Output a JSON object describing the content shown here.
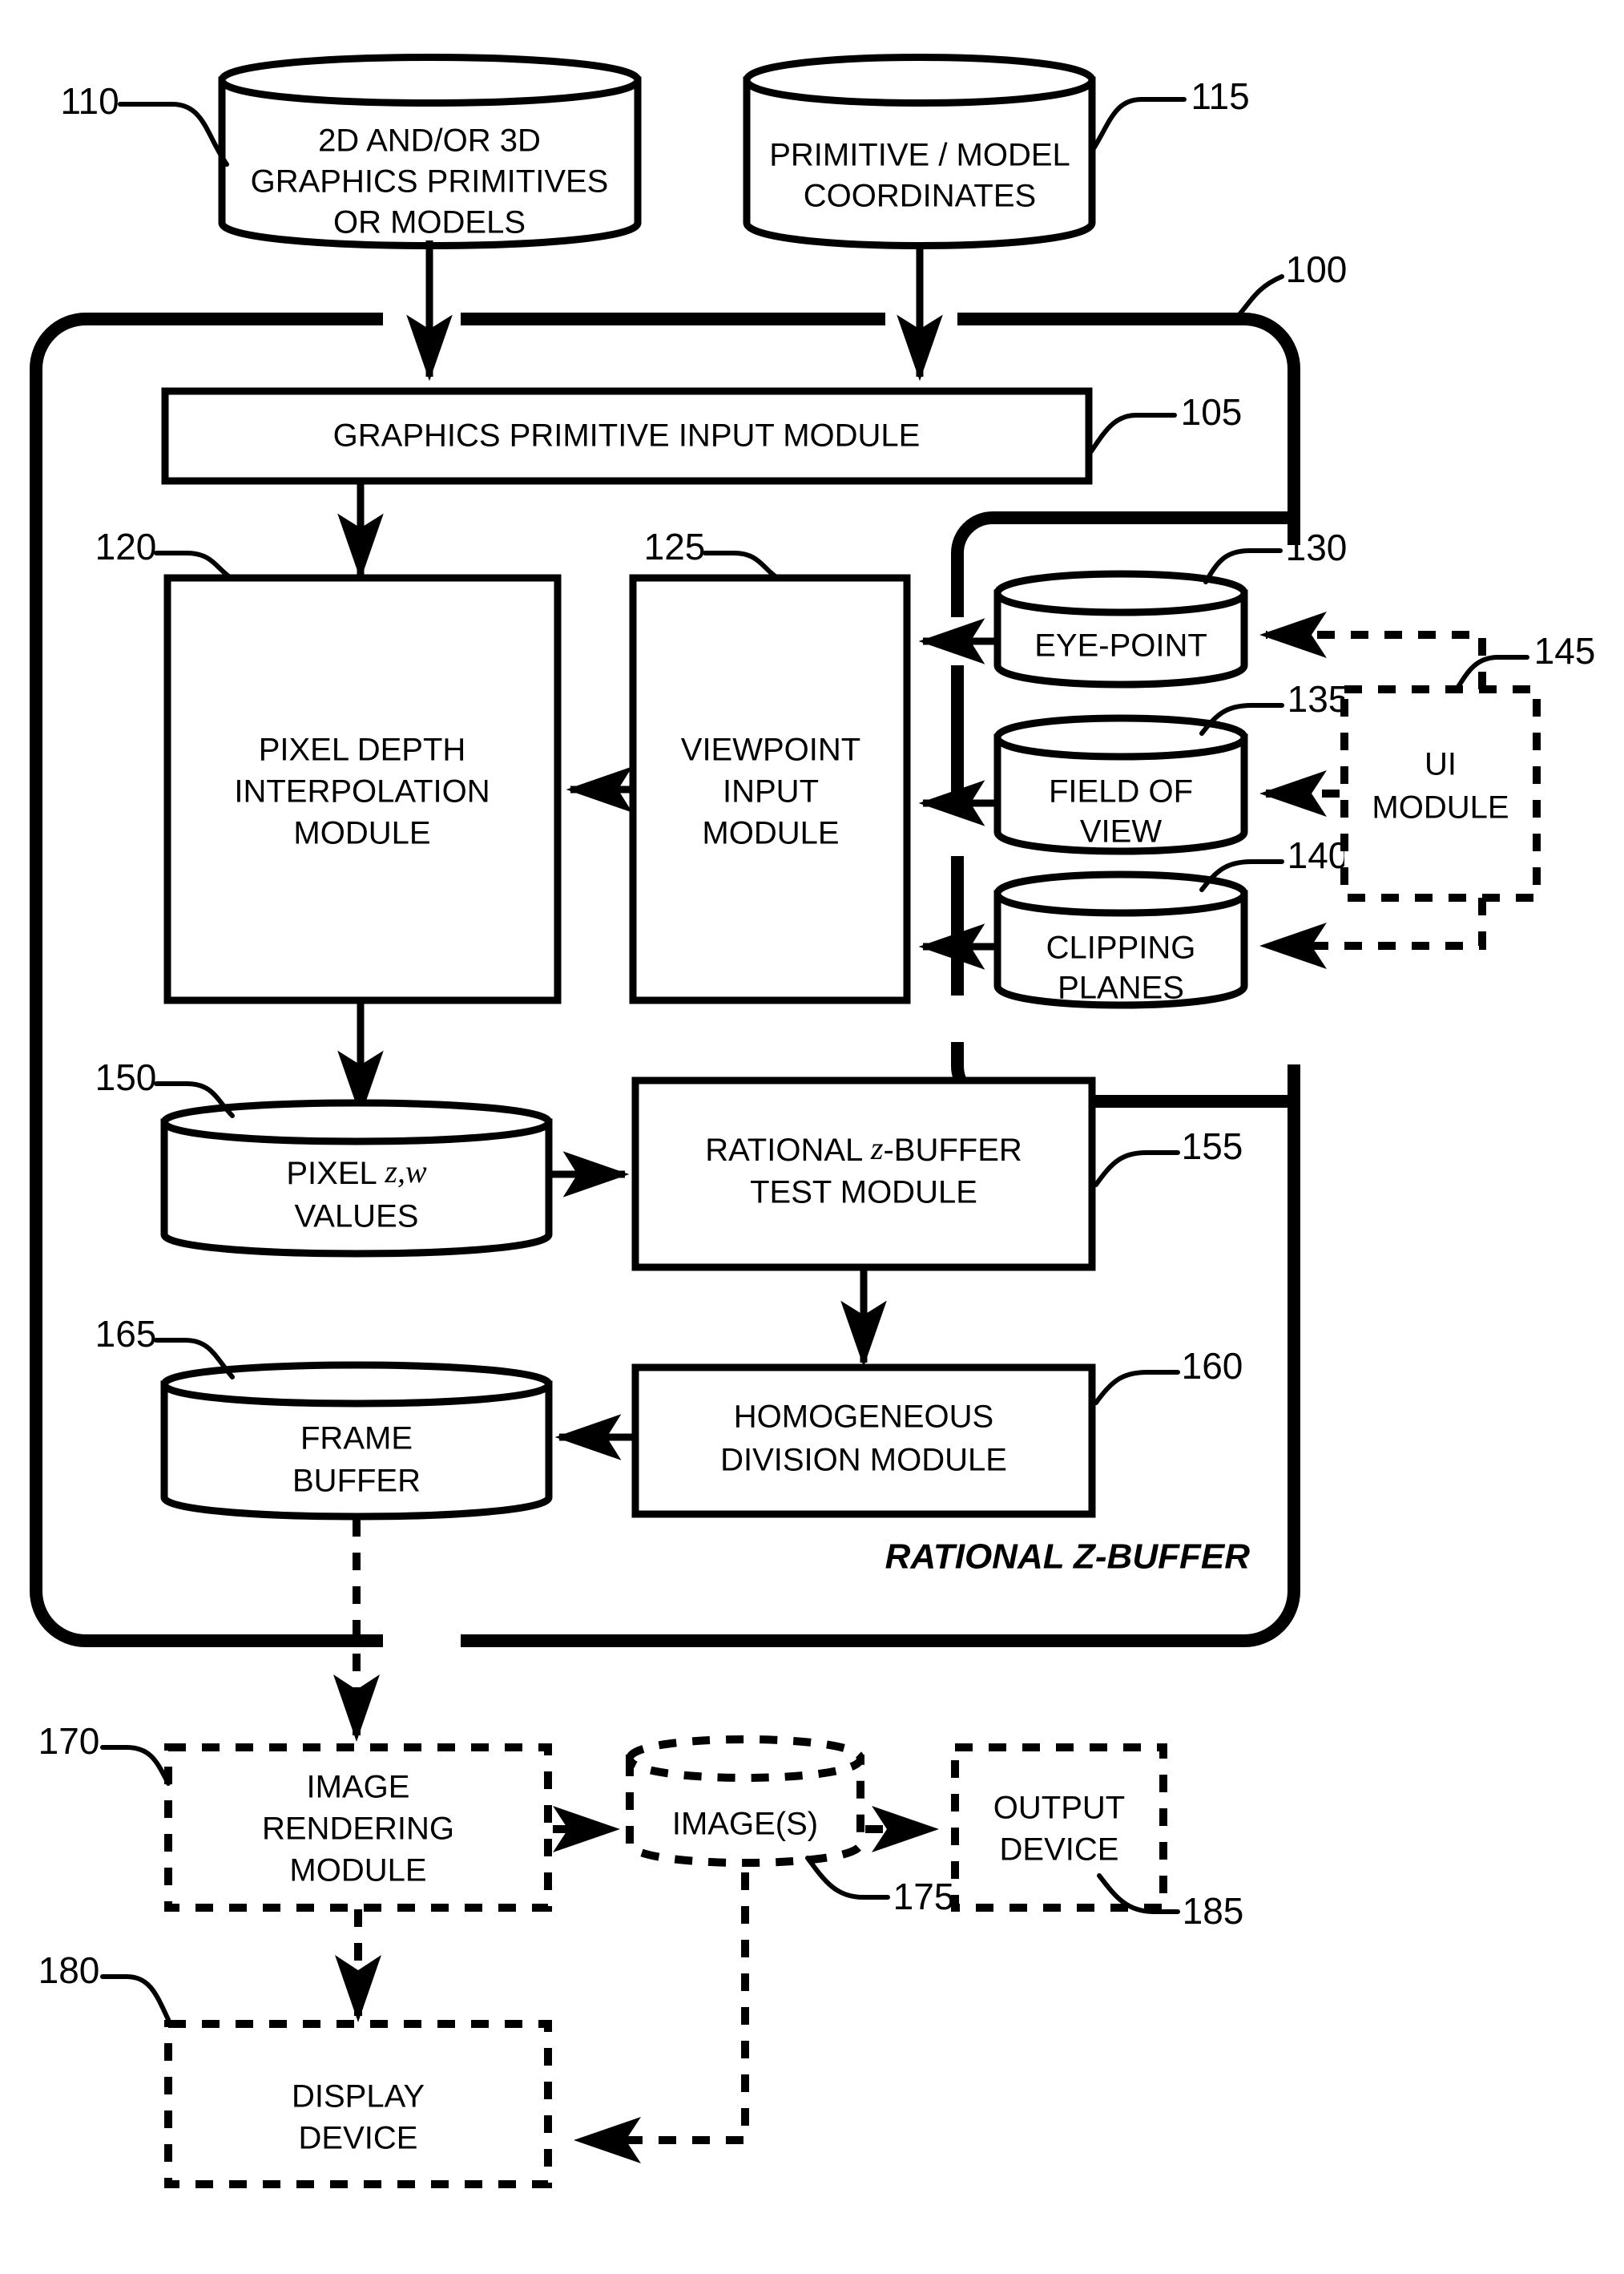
{
  "figure": {
    "title": "RATIONAL Z-BUFFER",
    "container_ref": "100"
  },
  "nodes": {
    "source_primitives": {
      "ref": "110",
      "shape": "cylinder",
      "style": "solid",
      "lines": [
        "2D AND/OR 3D",
        "GRAPHICS PRIMITIVES",
        "OR MODELS"
      ]
    },
    "source_coordinates": {
      "ref": "115",
      "shape": "cylinder",
      "style": "solid",
      "lines": [
        "PRIMITIVE / MODEL",
        "COORDINATES"
      ]
    },
    "graphics_primitive_input_module": {
      "ref": "105",
      "shape": "box",
      "style": "solid",
      "lines": [
        "GRAPHICS PRIMITIVE INPUT MODULE"
      ]
    },
    "pixel_depth_interpolation_module": {
      "ref": "120",
      "shape": "box",
      "style": "solid",
      "lines": [
        "PIXEL DEPTH",
        "INTERPOLATION",
        "MODULE"
      ]
    },
    "viewpoint_input_module": {
      "ref": "125",
      "shape": "box",
      "style": "solid",
      "lines": [
        "VIEWPOINT",
        "INPUT",
        "MODULE"
      ]
    },
    "eye_point": {
      "ref": "130",
      "shape": "cylinder",
      "style": "solid",
      "lines": [
        "EYE-POINT"
      ]
    },
    "field_of_view": {
      "ref": "135",
      "shape": "cylinder",
      "style": "solid",
      "lines": [
        "FIELD OF",
        "VIEW"
      ]
    },
    "clipping_planes": {
      "ref": "140",
      "shape": "cylinder",
      "style": "solid",
      "lines": [
        "CLIPPING",
        "PLANES"
      ]
    },
    "ui_module": {
      "ref": "145",
      "shape": "box",
      "style": "dashed",
      "lines": [
        "UI",
        "MODULE"
      ]
    },
    "pixel_zw_values": {
      "ref": "150",
      "shape": "cylinder",
      "style": "solid",
      "line1_prefix": "PIXEL ",
      "line1_italic": "z,w",
      "line2": "VALUES"
    },
    "rational_z_buffer_test_module": {
      "ref": "155",
      "shape": "box",
      "style": "solid",
      "line1_prefix": "RATIONAL ",
      "line1_italic": "z",
      "line1_suffix": "-BUFFER",
      "line2": "TEST MODULE"
    },
    "homogeneous_division_module": {
      "ref": "160",
      "shape": "box",
      "style": "solid",
      "lines": [
        "HOMOGENEOUS",
        "DIVISION MODULE"
      ]
    },
    "frame_buffer": {
      "ref": "165",
      "shape": "cylinder",
      "style": "solid",
      "lines": [
        "FRAME",
        "BUFFER"
      ]
    },
    "image_rendering_module": {
      "ref": "170",
      "shape": "box",
      "style": "dashed",
      "lines": [
        "IMAGE",
        "RENDERING",
        "MODULE"
      ]
    },
    "images": {
      "ref": "175",
      "shape": "cylinder",
      "style": "dashed",
      "lines": [
        "IMAGE(S)"
      ]
    },
    "display_device": {
      "ref": "180",
      "shape": "box",
      "style": "dashed",
      "lines": [
        "DISPLAY",
        "DEVICE"
      ]
    },
    "output_device": {
      "ref": "185",
      "shape": "box",
      "style": "dashed",
      "lines": [
        "OUTPUT",
        "DEVICE"
      ]
    }
  },
  "reference_numerals": [
    "100",
    "105",
    "110",
    "115",
    "120",
    "125",
    "130",
    "135",
    "140",
    "145",
    "150",
    "155",
    "160",
    "165",
    "170",
    "175",
    "180",
    "185"
  ],
  "colors": {
    "stroke": "#000000",
    "fill": "#ffffff"
  }
}
